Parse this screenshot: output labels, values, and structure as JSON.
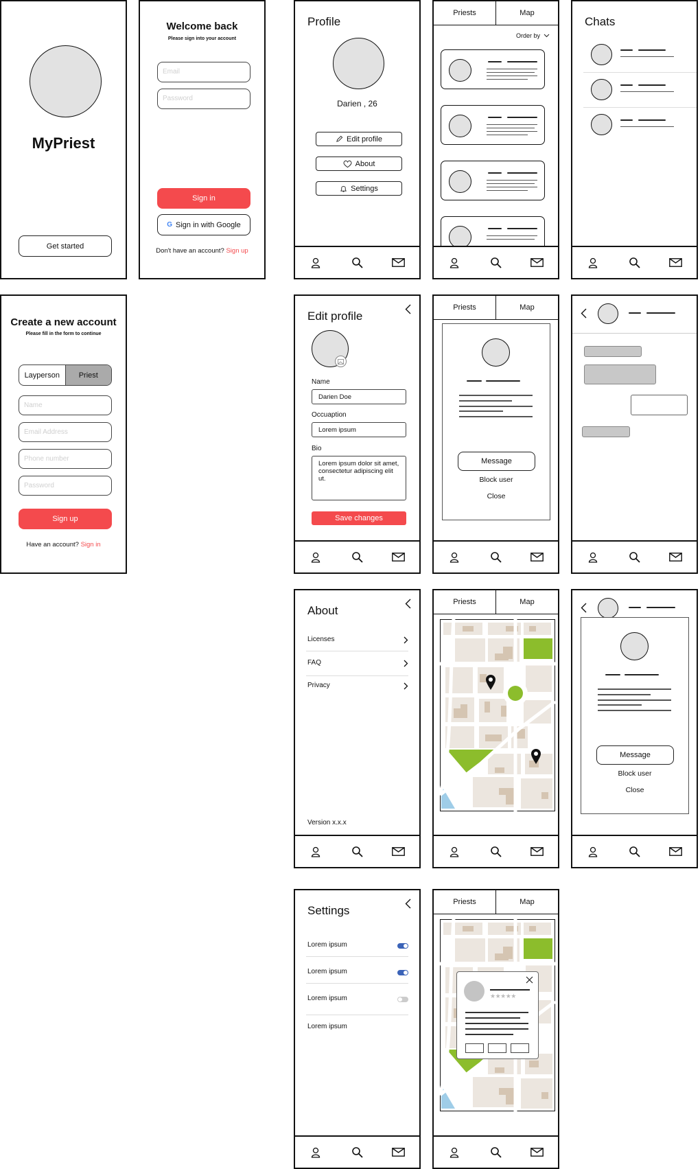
{
  "splash": {
    "app_name": "MyPriest",
    "get_started": "Get started"
  },
  "login": {
    "title": "Welcome back",
    "subtitle": "Please sign into your account",
    "email_placeholder": "Email",
    "password_placeholder": "Password",
    "sign_in": "Sign in",
    "google": "Sign in with Google",
    "no_account": "Don't have an account?",
    "sign_up_link": "Sign up"
  },
  "profile": {
    "title": "Profile",
    "name_age": "Darien , 26",
    "edit_profile": "Edit profile",
    "about": "About",
    "settings": "Settings"
  },
  "tabs": {
    "priests": "Priests",
    "map": "Map",
    "order_by": "Order by"
  },
  "chats": {
    "title": "Chats"
  },
  "signup": {
    "title": "Create a new account",
    "subtitle": "Please fill in the form to continue",
    "layperson": "Layperson",
    "priest": "Priest",
    "name_placeholder": "Name",
    "email_placeholder": "Email Address",
    "phone_placeholder": "Phone number",
    "password_placeholder": "Password",
    "sign_up": "Sign up",
    "have_account": "Have an account?",
    "sign_in_link": "Sign in"
  },
  "edit_profile": {
    "title": "Edit profile",
    "name_label": "Name",
    "name_value": "Darien Doe",
    "occupation_label": "Occuaption",
    "occupation_value": "Lorem ipsum",
    "bio_label": "Bio",
    "bio_value": "Lorem ipsum dolor sit amet, consectetur adipiscing elit ut.",
    "save": "Save changes"
  },
  "priest_modal": {
    "message": "Message",
    "block": "Block user",
    "close": "Close"
  },
  "about": {
    "title": "About",
    "items": [
      "Licenses",
      "FAQ",
      "Privacy"
    ],
    "version": "Version x.x.x"
  },
  "settings": {
    "title": "Settings",
    "items": [
      {
        "label": "Lorem ipsum",
        "on": true
      },
      {
        "label": "Lorem ipsum",
        "on": true
      },
      {
        "label": "Lorem ipsum",
        "on": false
      },
      {
        "label": "Lorem ipsum"
      }
    ]
  },
  "map_popup": {
    "stars": "★★★★★"
  },
  "colors": {
    "accent": "#f44a4d",
    "toggle_on": "#3b63b8",
    "map_green": "#8cbd2c",
    "map_block": "#ece6df"
  },
  "icons": [
    "user-icon",
    "search-icon",
    "mail-icon",
    "pencil-icon",
    "heart-icon",
    "bell-icon",
    "back-icon",
    "chevron-right-icon",
    "close-icon",
    "map-pin-icon",
    "google-icon"
  ]
}
